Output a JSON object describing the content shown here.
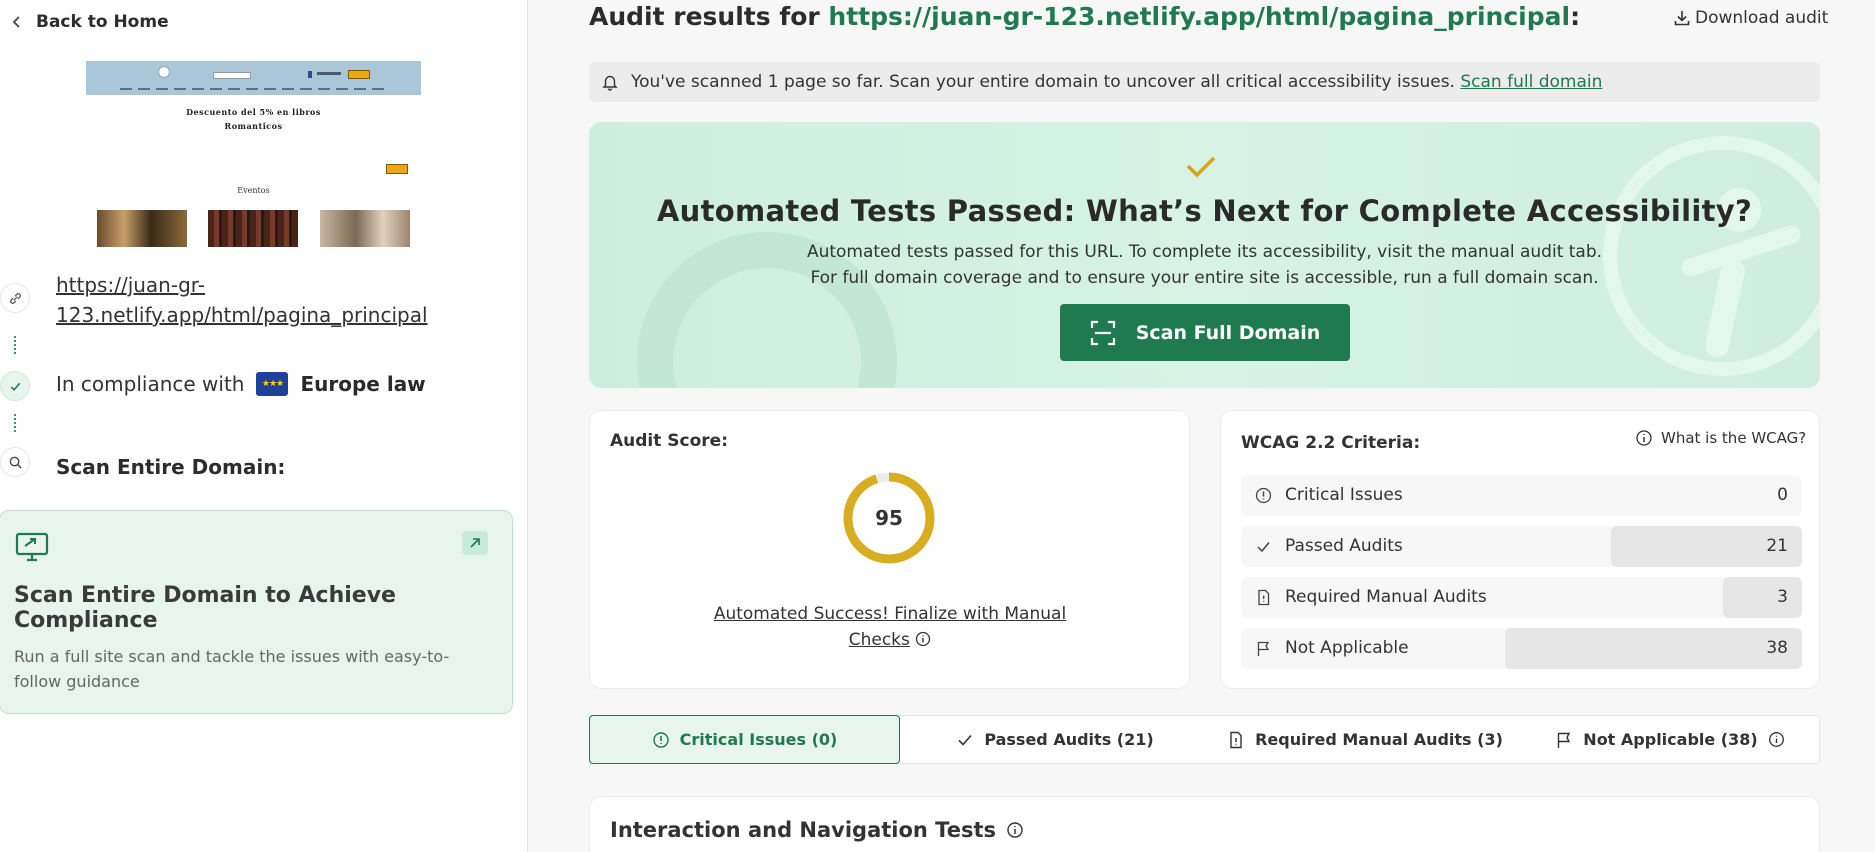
{
  "sidebar": {
    "back_label": "Back to Home",
    "preview": {
      "heading_line1": "Descuento del 5% en libros",
      "heading_line2": "Romanticos",
      "events_label": "Eventos"
    },
    "url": "https://juan-gr-123.netlify.app/html/pagina_principal",
    "compliance_prefix": "In compliance with",
    "compliance_law": "Europe law",
    "scan_domain_label": "Scan Entire Domain:",
    "scan_card": {
      "title": "Scan Entire Domain to Achieve Compliance",
      "description": "Run a full site scan and tackle the issues with easy-to-follow guidance"
    }
  },
  "header": {
    "title_prefix": "Audit results for ",
    "title_url": "https://juan-gr-123.netlify.app/html/pagina_principal",
    "title_suffix": ":",
    "download_label": "Download audit"
  },
  "notice": {
    "text": "You've scanned 1 page so far. Scan your entire domain to uncover all critical accessibility issues.",
    "link": "Scan full domain"
  },
  "hero": {
    "title": "Automated Tests Passed: What’s Next for Complete Accessibility?",
    "line1": "Automated tests passed for this URL. To complete its accessibility, visit the manual audit tab.",
    "line2": "For full domain coverage and to ensure your entire site is accessible, run a full domain scan.",
    "button": "Scan Full Domain"
  },
  "score": {
    "label": "Audit Score:",
    "value": "95",
    "fraction": 0.95,
    "message": "Automated Success! Finalize with Manual Checks"
  },
  "wcag": {
    "label": "WCAG 2.2 Criteria:",
    "help": "What is the WCAG?",
    "rows": [
      {
        "name": "Critical Issues",
        "count": "0",
        "share": 0.0,
        "icon": "alert-circle-icon"
      },
      {
        "name": "Passed Audits",
        "count": "21",
        "share": 0.34,
        "icon": "check-icon"
      },
      {
        "name": "Required Manual Audits",
        "count": "3",
        "share": 0.14,
        "icon": "document-icon"
      },
      {
        "name": "Not Applicable",
        "count": "38",
        "share": 0.53,
        "icon": "flag-icon"
      }
    ]
  },
  "tabs": [
    {
      "label": "Critical Issues (0)",
      "icon": "alert-circle-icon",
      "active": true
    },
    {
      "label": "Passed Audits (21)",
      "icon": "check-icon",
      "active": false
    },
    {
      "label": "Required Manual Audits (3)",
      "icon": "document-icon",
      "active": false
    },
    {
      "label": "Not Applicable (38)",
      "icon": "flag-icon",
      "active": false
    }
  ],
  "tests": {
    "title": "Interaction and Navigation Tests"
  },
  "colors": {
    "brand_green": "#1f7a50",
    "hero_bg": "#d6f3e5",
    "score_ring": "#d9ad22",
    "check_mark": "#d9a21b"
  }
}
